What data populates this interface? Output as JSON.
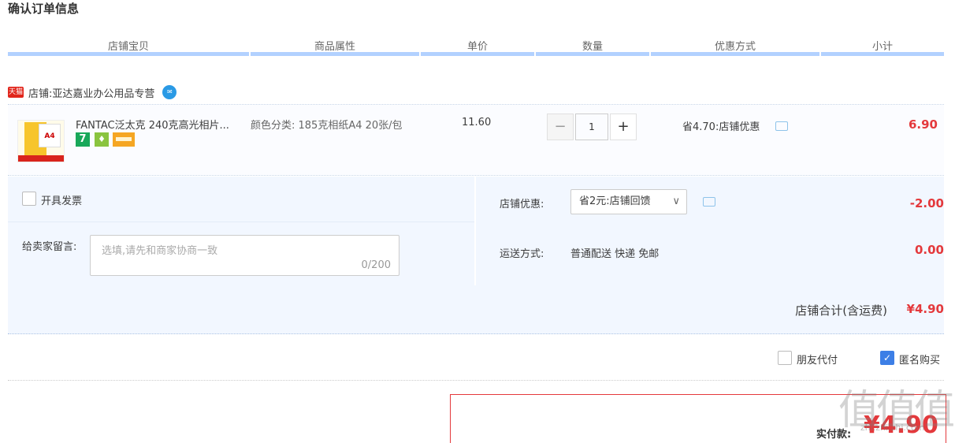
{
  "page_title": "确认订单信息",
  "columns": [
    "店铺宝贝",
    "商品属性",
    "单价",
    "数量",
    "优惠方式",
    "小计"
  ],
  "shop": {
    "tmall_label": "天猫",
    "prefix": "店铺:",
    "name": "亚达嘉业办公用品专营"
  },
  "item": {
    "title": "FANTAC泛太克 240克高光相片...",
    "thumb_text": "A4",
    "badge_7": "7",
    "badge_shield": "♦",
    "attributes": "颜色分类: 185克相纸A4 20张/包",
    "unit_price": "11.60",
    "quantity": "1",
    "qty_minus": "−",
    "qty_plus": "+",
    "discount": "省4.70:店铺优惠",
    "subtotal": "6.90"
  },
  "invoice": {
    "label": "开具发票"
  },
  "message": {
    "label": "给卖家留言:",
    "placeholder": "选填,请先和商家协商一致",
    "counter": "0/200"
  },
  "shop_coupon": {
    "label": "店铺优惠:",
    "selected": "省2元:店铺回馈",
    "amount": "-2.00"
  },
  "shipping": {
    "label": "运送方式:",
    "method": "普通配送 快递 免邮",
    "amount": "0.00"
  },
  "shop_total": {
    "label": "店铺合计(含运费)",
    "value": "¥4.90"
  },
  "options": {
    "friend_pay": "朋友代付",
    "anonymous": "匿名购买",
    "anonymous_checked": true
  },
  "pay": {
    "label": "实付款:",
    "value": "¥4.90"
  },
  "watermark": {
    "text": "值值值",
    "url": "zhi.zhi.zhi.com"
  },
  "colors": {
    "accent_red": "#e4393c",
    "header_blue": "#b2d1ff",
    "panel_blue": "#f2f7ff"
  }
}
